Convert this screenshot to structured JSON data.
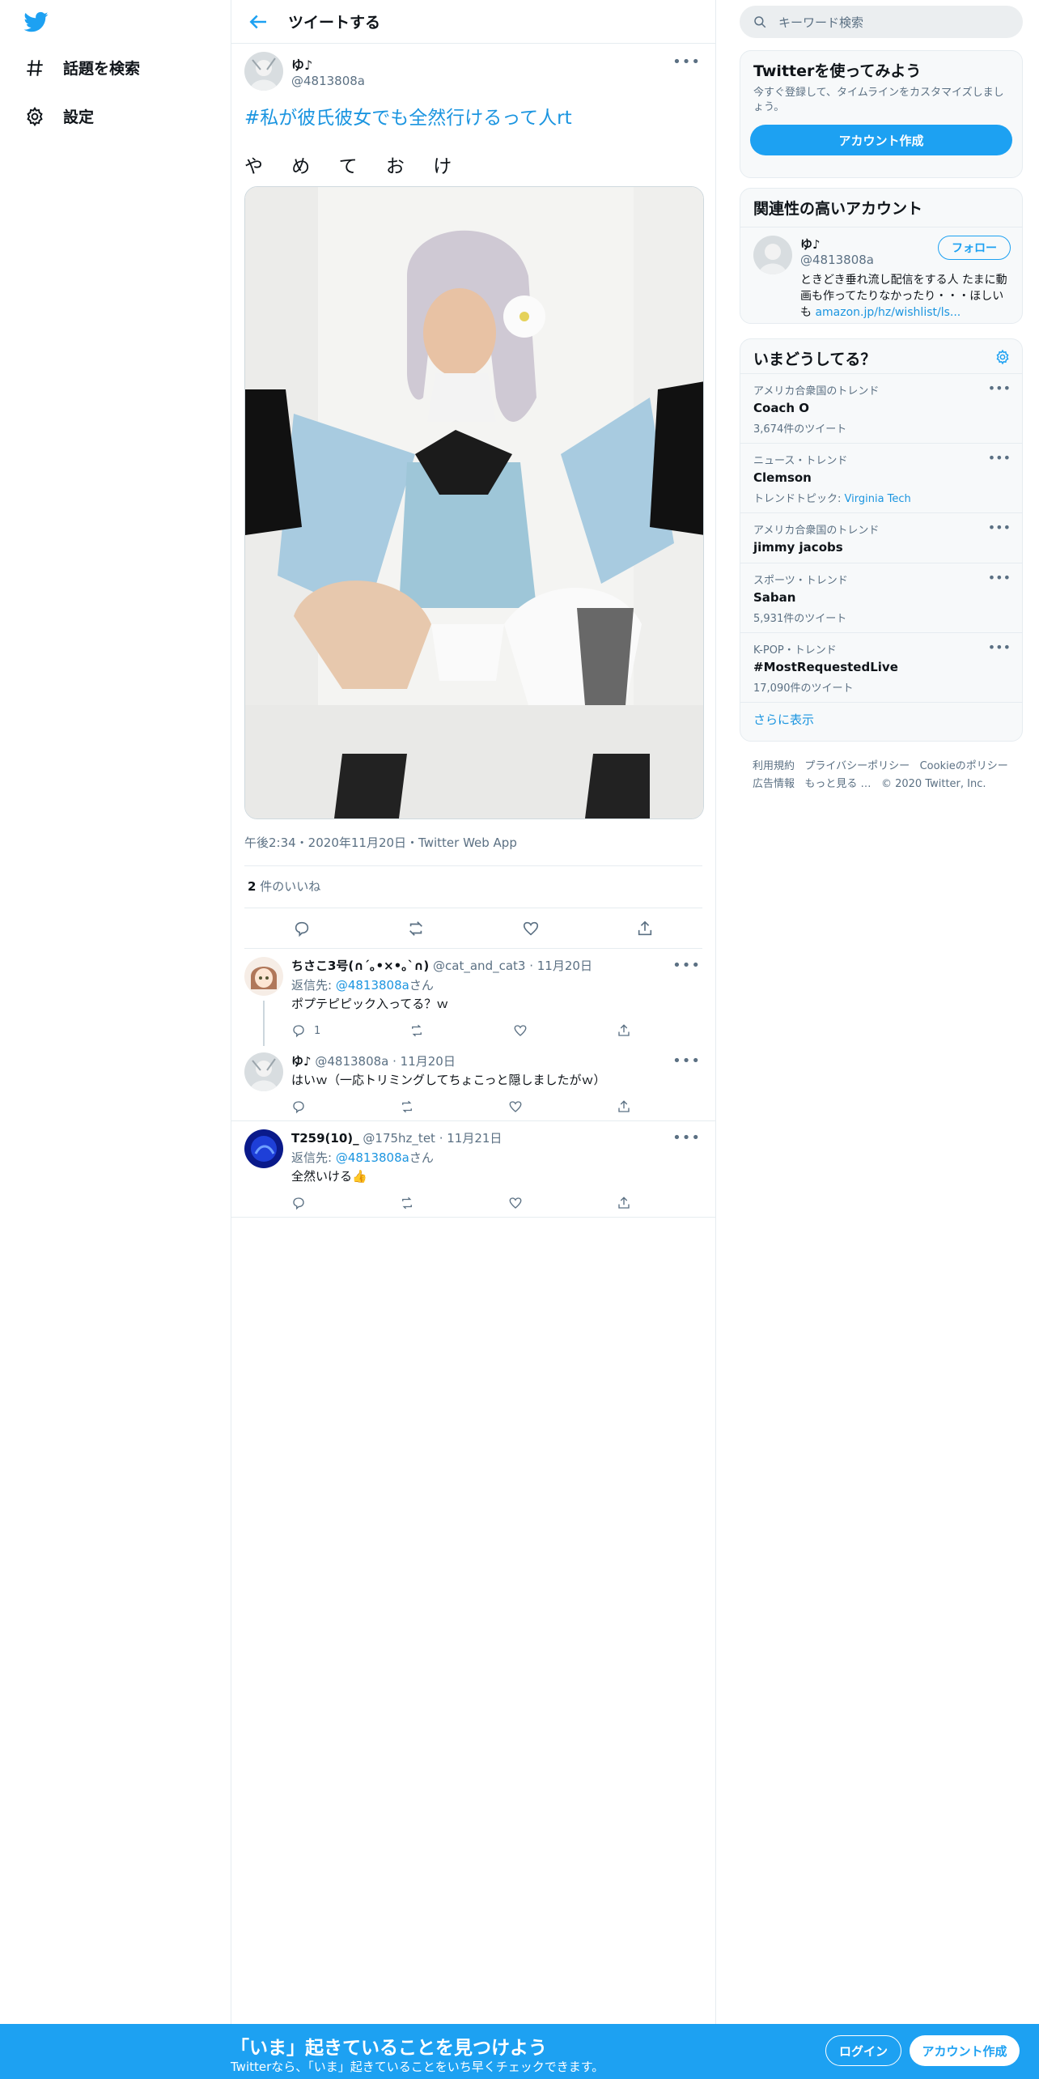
{
  "nav": {
    "items": [
      {
        "label": "話題を検索",
        "icon": "hashtag-icon"
      },
      {
        "label": "設定",
        "icon": "gear-icon"
      }
    ]
  },
  "header": {
    "title": "ツイートする"
  },
  "tweet": {
    "name": "ゆ♪",
    "handle": "@4813808a",
    "hashtag": "#私が彼氏彼女でも全然行けるって人rt",
    "text": "や め て お け",
    "meta": "午後2:34・2020年11月20日・Twitter Web App",
    "likes_count": "2",
    "likes_label": "件のいいね"
  },
  "replies": [
    {
      "name": "ちさこ3号(∩´｡•×•｡`∩)",
      "handle": "@cat_and_cat3",
      "date": "11月20日",
      "reply_to_prefix": "返信先: ",
      "reply_to_link": "@4813808a",
      "reply_to_suffix": "さん",
      "text": "ポプテピピック入ってる？ｗ",
      "reply_count": "1"
    },
    {
      "name": "ゆ♪",
      "handle": "@4813808a",
      "date": "11月20日",
      "text": "はいｗ（一応トリミングしてちょこっと隠しましたがｗ）",
      "reply_count": ""
    },
    {
      "name": "T259(10)_",
      "handle": "@175hz_tet",
      "date": "11月21日",
      "reply_to_prefix": "返信先: ",
      "reply_to_link": "@4813808a",
      "reply_to_suffix": "さん",
      "text": "全然いける👍",
      "reply_count": ""
    }
  ],
  "search": {
    "placeholder": "キーワード検索"
  },
  "signup_card": {
    "title": "Twitterを使ってみよう",
    "subtitle": "今すぐ登録して、タイムラインをカスタマイズしましょう。",
    "button": "アカウント作成"
  },
  "related": {
    "title": "関連性の高いアカウント",
    "name": "ゆ♪",
    "handle": "@4813808a",
    "follow": "フォロー",
    "bio": "ときどき垂れ流し配信をする人 たまに動画も作ってたりなかったり・・・ほしいも",
    "bio_link": "amazon.jp/hz/wishlist/ls..."
  },
  "trends": {
    "title": "いまどうしてる？",
    "items": [
      {
        "category": "アメリカ合衆国のトレンド",
        "name": "Coach O",
        "meta": "3,674件のツイート"
      },
      {
        "category": "ニュース・トレンド",
        "name": "Clemson",
        "meta_prefix": "トレンドトピック: ",
        "meta_link": "Virginia Tech"
      },
      {
        "category": "アメリカ合衆国のトレンド",
        "name": "jimmy jacobs",
        "meta": ""
      },
      {
        "category": "スポーツ・トレンド",
        "name": "Saban",
        "meta": "5,931件のツイート"
      },
      {
        "category": "K-POP・トレンド",
        "name": "#MostRequestedLive",
        "meta": "17,090件のツイート"
      }
    ],
    "show_more": "さらに表示"
  },
  "footer": {
    "links": [
      "利用規約",
      "プライバシーポリシー",
      "Cookieのポリシー",
      "広告情報",
      "もっと見る …"
    ],
    "copyright": "© 2020 Twitter, Inc."
  },
  "bottom_bar": {
    "title": "「いま」起きていることを見つけよう",
    "subtitle": "Twitterなら、「いま」起きていることをいち早くチェックできます。",
    "login": "ログイン",
    "signup": "アカウント作成"
  },
  "colors": {
    "accent": "#1da1f2",
    "link": "#1b95e0",
    "muted": "#5b7083"
  }
}
